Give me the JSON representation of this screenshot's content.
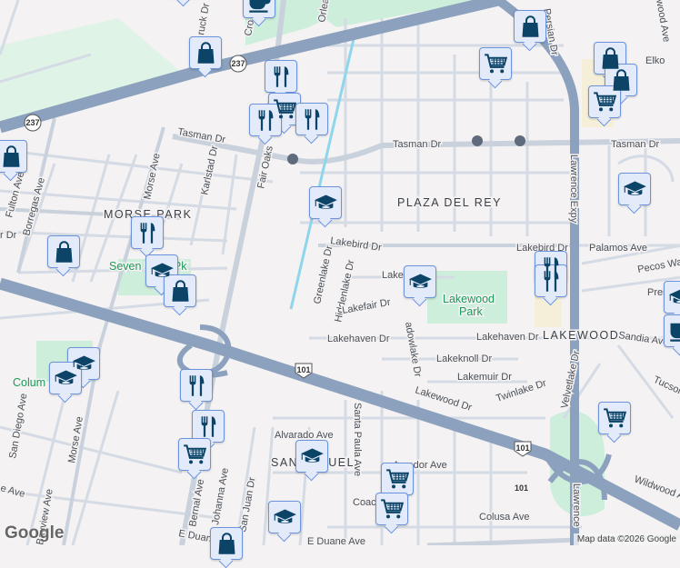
{
  "markers": [
    {
      "type": "shopping",
      "icon": "#i-shop"
    },
    {
      "type": "coffee",
      "icon": "#i-coffee"
    },
    {
      "type": "shopping",
      "icon": "#i-shop"
    },
    {
      "type": "restaurant",
      "icon": "#i-rest"
    },
    {
      "type": "grocery",
      "icon": "#i-cart"
    },
    {
      "type": "restaurant",
      "icon": "#i-rest"
    },
    {
      "type": "restaurant",
      "icon": "#i-rest"
    },
    {
      "type": "school",
      "icon": "#i-school"
    },
    {
      "type": "shopping",
      "icon": "#i-shop"
    },
    {
      "type": "restaurant",
      "icon": "#i-rest"
    },
    {
      "type": "shopping",
      "icon": "#i-shop"
    },
    {
      "type": "school",
      "icon": "#i-school"
    },
    {
      "type": "shopping",
      "icon": "#i-shop"
    },
    {
      "type": "school",
      "icon": "#i-school"
    },
    {
      "type": "restaurant",
      "icon": "#i-rest"
    },
    {
      "type": "restaurant",
      "icon": "#i-rest"
    },
    {
      "type": "school",
      "icon": "#i-school"
    },
    {
      "type": "grocery",
      "icon": "#i-cart"
    },
    {
      "type": "shopping",
      "icon": "#i-shop"
    },
    {
      "type": "shopping",
      "icon": "#i-shop"
    },
    {
      "type": "shopping",
      "icon": "#i-shop"
    },
    {
      "type": "grocery",
      "icon": "#i-cart"
    },
    {
      "type": "school",
      "icon": "#i-school"
    },
    {
      "type": "coffee",
      "icon": "#i-coffee"
    },
    {
      "type": "school",
      "icon": "#i-school"
    },
    {
      "type": "school",
      "icon": "#i-school"
    },
    {
      "type": "restaurant",
      "icon": "#i-rest"
    },
    {
      "type": "restaurant",
      "icon": "#i-rest"
    },
    {
      "type": "grocery",
      "icon": "#i-cart"
    },
    {
      "type": "school",
      "icon": "#i-school"
    },
    {
      "type": "grocery",
      "icon": "#i-cart"
    },
    {
      "type": "grocery",
      "icon": "#i-cart"
    },
    {
      "type": "school",
      "icon": "#i-school"
    },
    {
      "type": "grocery",
      "icon": "#i-cart"
    },
    {
      "type": "shopping",
      "icon": "#i-shop"
    }
  ],
  "labels": {
    "tasman1": "Tasman Dr",
    "tasman2": "Tasman Dr",
    "tasman3": "Tasman Dr",
    "fair_oaks": "Fair Oaks",
    "morse1": "Morse Ave",
    "morse2": "Morse Ave",
    "karlstad": "Karlstad Dr",
    "morse_park": "MORSE PARK",
    "borregas": "Borregas Ave",
    "fulton": "Fulton Ave",
    "plaza": "PLAZA DEL REY",
    "lakebird1": "Lakebird Dr",
    "lakebird2": "Lakebird Dr",
    "palamos": "Palamos Ave",
    "pecos": "Pecos Wa",
    "pres": "Pres",
    "greenlake": "Greenlake Dr",
    "hiddenlake": "Hiddenlake Dr",
    "lakefair": "Lakefair Dr",
    "lake_dr": "Lake        Dr",
    "meadowlake": "adowlake Dr",
    "lakehaven1": "Lakehaven Dr",
    "lakehaven2": "Lakehaven Dr",
    "lakewood": "LAKEWOOD",
    "sandia": "Sandia Ave",
    "lakeknoll": "Lakeknoll Dr",
    "lakemuir": "Lakemuir Dr",
    "twinlake": "Twinlake Dr",
    "lakewood_dr": "Lakewood Dr",
    "velvetlake": "Velvetlake Dr",
    "tucson": "Tucson",
    "lawrence1": "Lawrence Expy",
    "lawrence2": "Lawrence",
    "elko": "Elko",
    "alvarado": "Alvarado Ave",
    "san_miguel": "SAN MIGUEL",
    "amador": "Amador Ave",
    "santa_paula": "Santa Paula Ave",
    "colusa": "Colusa Ave",
    "coach": "Coach",
    "duane1": "E Duane Ave",
    "duane2": "E Duane Ave",
    "bernal": "Bernal Ave",
    "johanna": "Johanna Ave",
    "san_juan": "San Juan Dr",
    "san_diego": "San Diego Ave",
    "bayview": "Bayview Ave",
    "wildwood": "Wildwood Ave",
    "seven_seas": "Seven Seas Pk",
    "columbia": "Colum",
    "crossman": "Cro",
    "orleans": "Orlea",
    "persian": "Persian Dr",
    "lakewood_park_1": "Lakewood",
    "lakewood_park_2": "Park",
    "wood_ave": "wood Ave",
    "hwy237a": "237",
    "hwy237b": "237",
    "hwy101a": "101",
    "hwy101b": "101",
    "hwy101c": "101",
    "dr_left": "r Dr",
    "ave_left": "e Ave",
    "truck": "ruck Dr"
  },
  "attribution": "Map data ©2026 Google",
  "logo": "Google"
}
